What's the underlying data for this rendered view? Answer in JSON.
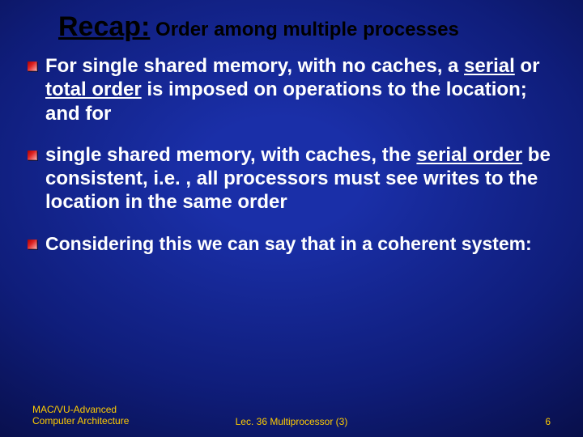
{
  "title": {
    "main": "Recap:",
    "sub": " Order among multiple processes"
  },
  "bullets": {
    "b1": {
      "pre": "For single shared memory",
      "mid1": ", with no caches,",
      "br": " a ",
      "u1": "serial",
      "mid2": " or ",
      "u2": "total order",
      "post": " is imposed on operations to the location; and for"
    },
    "b2": {
      "pre": "single shared memory",
      "mid1": ", with caches,",
      "mid2": " the ",
      "u1": "serial order",
      "post": " be consistent, i.e. , all processors must see writes to the location in the same order"
    },
    "b3": {
      "text": "Considering this we can say that in a coherent system:"
    }
  },
  "footer": {
    "left1": "MAC/VU-Advanced",
    "left2": "Computer Architecture",
    "center": "Lec. 36 Multiprocessor (3)",
    "right": "6"
  }
}
